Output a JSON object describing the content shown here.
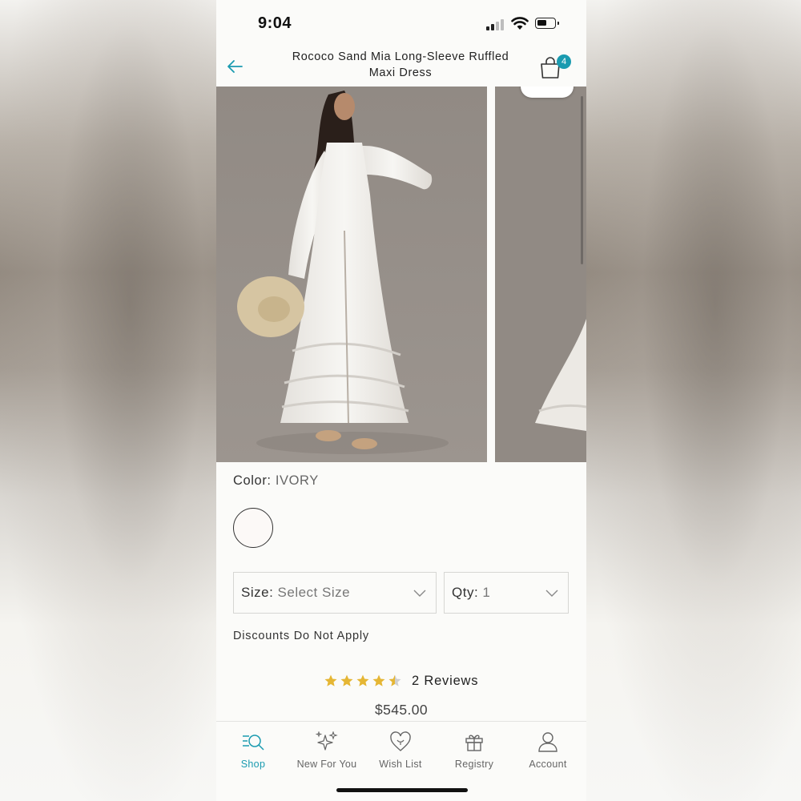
{
  "status_bar": {
    "time": "9:04"
  },
  "header": {
    "title": "Rococo Sand Mia Long-Sleeve Ruffled Maxi Dress",
    "cart_count": "4"
  },
  "product": {
    "color_label": "Color:",
    "color_value": "IVORY",
    "size_label": "Size:",
    "size_value": "Select Size",
    "qty_label": "Qty:",
    "qty_value": "1",
    "discounts_note": "Discounts Do Not Apply",
    "rating": 4.5,
    "reviews": "2 Reviews",
    "price": "$545.00"
  },
  "tabs": [
    {
      "label": "Shop",
      "icon": "shop-search-icon",
      "active": true
    },
    {
      "label": "New For You",
      "icon": "sparkles-icon",
      "active": false
    },
    {
      "label": "Wish List",
      "icon": "heart-icon",
      "active": false
    },
    {
      "label": "Registry",
      "icon": "gift-icon",
      "active": false
    },
    {
      "label": "Account",
      "icon": "person-icon",
      "active": false
    }
  ],
  "colors": {
    "accent": "#1a9bb0",
    "star": "#e5b634",
    "swatch": "#fcf9f7"
  }
}
